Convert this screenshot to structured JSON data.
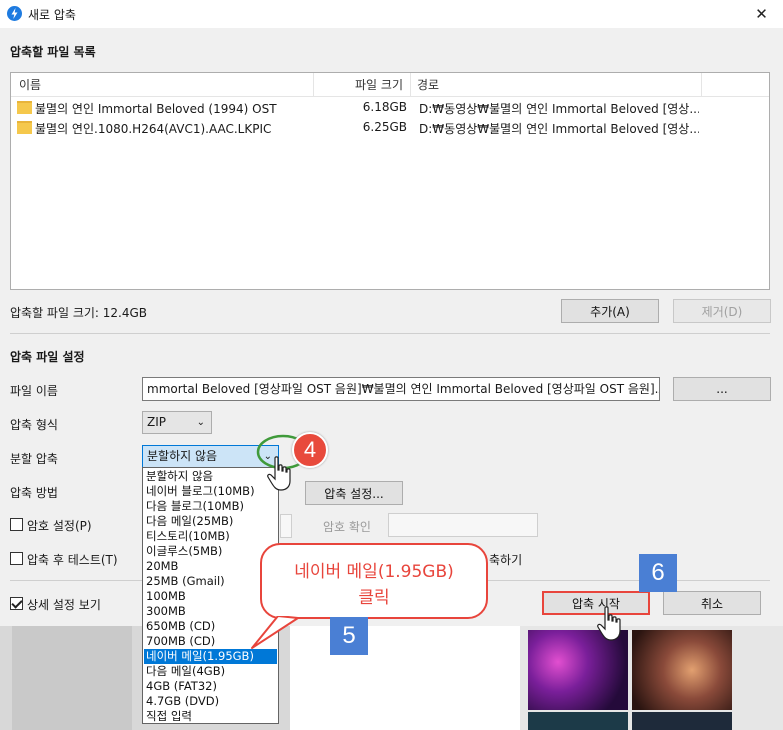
{
  "window": {
    "title": "새로 압축",
    "close_glyph": "✕"
  },
  "file_list": {
    "section_title": "압축할 파일 목록",
    "columns": [
      "이름",
      "파일 크기",
      "경로"
    ],
    "rows": [
      {
        "name": "불멸의 연인 Immortal Beloved (1994) OST",
        "size": "6.18GB",
        "path": "D:₩동영상₩불멸의 연인 Immortal Beloved [영상..."
      },
      {
        "name": "불멸의 연인.1080.H264(AVC1).AAC.LKPIC",
        "size": "6.25GB",
        "path": "D:₩동영상₩불멸의 연인 Immortal Beloved [영상..."
      }
    ],
    "total_label": "압축할 파일 크기: 12.4GB",
    "add_button": "추가(A)",
    "remove_button": "제거(D)"
  },
  "settings": {
    "section_title": "압축 파일 설정",
    "filename_label": "파일 이름",
    "filename_value": "mmortal Beloved [영상파일 OST 음원]₩불멸의 연인 Immortal Beloved [영상파일 OST 음원].zip",
    "browse_button": "...",
    "format_label": "압축 형식",
    "format_value": "ZIP",
    "split_label": "분할 압축",
    "split_value": "분할하지 않음",
    "method_label": "압축 방법",
    "method_settings_button": "압축 설정...",
    "password_label": "암호 설정(P)",
    "password_confirm_label": "암호 확인",
    "test_label": "압축 후 테스트(T)",
    "partial_text": "축하기",
    "detail_label": "상세 설정 보기",
    "start_button": "압축 시작",
    "cancel_button": "취소"
  },
  "split_options": [
    "분할하지 않음",
    "네이버 블로그(10MB)",
    "다음 블로그(10MB)",
    "다음 메일(25MB)",
    "티스토리(10MB)",
    "이글루스(5MB)",
    "20MB",
    "25MB (Gmail)",
    "100MB",
    "300MB",
    "650MB (CD)",
    "700MB (CD)",
    "네이버 메일(1.95GB)",
    "다음 메일(4GB)",
    "4GB (FAT32)",
    "4.7GB (DVD)",
    "직접 입력"
  ],
  "split_selected_index": 12,
  "annotations": {
    "step4": "4",
    "step5": "5",
    "step6": "6",
    "bubble_line1": "네이버 메일(1.95GB)",
    "bubble_line2": "클릭"
  },
  "colors": {
    "accent": "#0078d7",
    "annotation_red": "#e8453c",
    "annotation_blue": "#4a7fd4",
    "highlight_green": "#3f9a3a"
  }
}
